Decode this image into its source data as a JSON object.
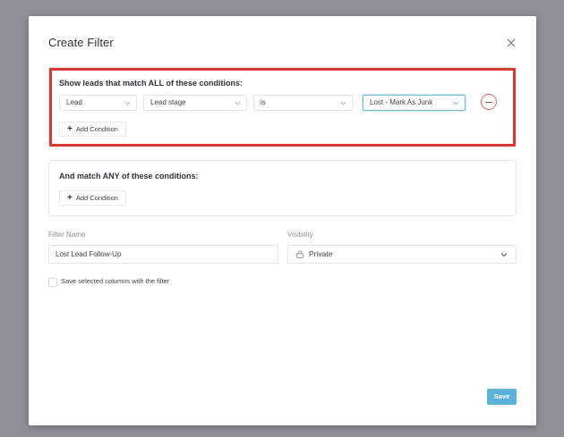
{
  "modal": {
    "title": "Create Filter",
    "close_icon": "close-icon"
  },
  "all_conditions": {
    "heading": "Show leads that match ALL of these conditions:",
    "condition": {
      "field": "Lead",
      "attribute": "Lead stage",
      "operator": "is",
      "value": "Lost - Mark As Junk"
    },
    "add_label": "Add Condition",
    "highlight_color": "#d63a32"
  },
  "any_conditions": {
    "heading": "And match ANY of these conditions:",
    "add_label": "Add Condition"
  },
  "filter_name": {
    "label": "Filter Name",
    "value": "Lost Lead Follow-Up"
  },
  "visibility": {
    "label": "Visibility",
    "value": "Private",
    "icon": "lock-icon"
  },
  "save_columns": {
    "label": "Save selected columns with the filter",
    "checked": false
  },
  "footer": {
    "save_label": "Save",
    "save_color": "#5bb2db"
  }
}
